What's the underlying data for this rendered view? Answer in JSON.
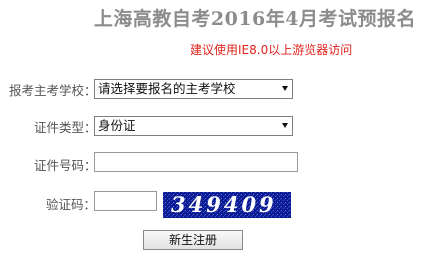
{
  "page": {
    "title": "上海高教自考2016年4月考试预报名",
    "browser_tip": "建议使用IE8.0以上游览器访问"
  },
  "form": {
    "school": {
      "label": "报考主考学校：",
      "selected": "请选择要报名的主考学校"
    },
    "id_type": {
      "label": "证件类型：",
      "selected": "身份证"
    },
    "id_number": {
      "label": "证件号码：",
      "value": ""
    },
    "captcha": {
      "label": "验证码：",
      "value": "",
      "image_text": "349409"
    },
    "register_button": "新生注册"
  }
}
